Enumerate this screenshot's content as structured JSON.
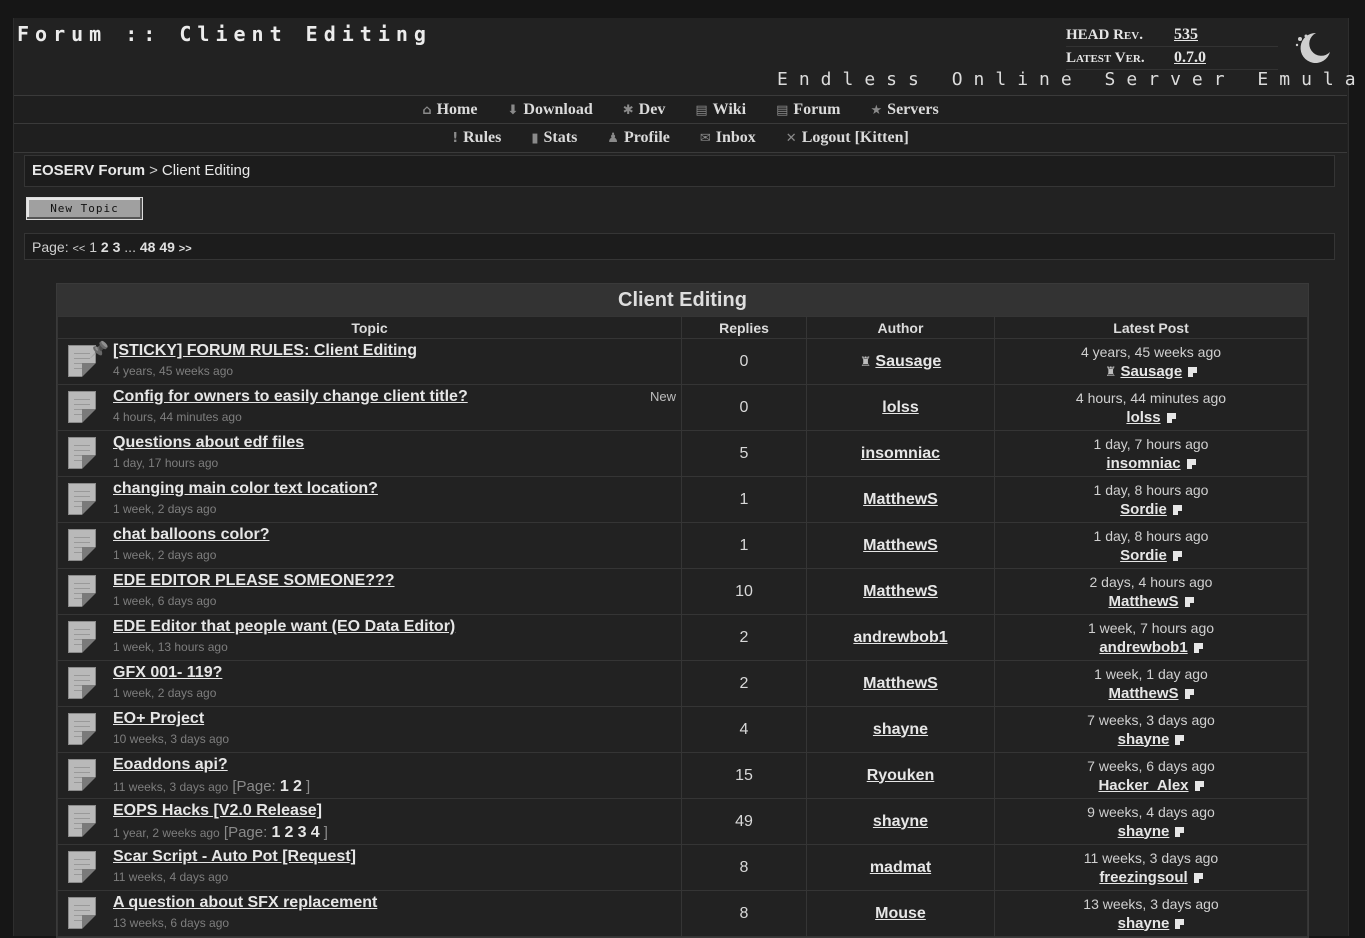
{
  "header": {
    "title": "Forum :: Client Editing",
    "subtitle": "Endless Online Server Emulator",
    "head_rev_label": "HEAD Rev.",
    "head_rev_value": "535",
    "latest_ver_label": "Latest Ver.",
    "latest_ver_value": "0.7.0"
  },
  "nav": {
    "row1": [
      {
        "label": "Home",
        "icon": "house-icon",
        "glyph": "⌂"
      },
      {
        "label": "Download",
        "icon": "download-icon",
        "glyph": "⬇"
      },
      {
        "label": "Dev",
        "icon": "bug-icon",
        "glyph": "✱"
      },
      {
        "label": "Wiki",
        "icon": "book-icon",
        "glyph": "▤"
      },
      {
        "label": "Forum",
        "icon": "document-icon",
        "glyph": "▤"
      },
      {
        "label": "Servers",
        "icon": "star-icon",
        "glyph": "★"
      }
    ],
    "row2": [
      {
        "label": "Rules",
        "icon": "exclamation-icon",
        "glyph": "!"
      },
      {
        "label": "Stats",
        "icon": "bar-chart-icon",
        "glyph": "▮"
      },
      {
        "label": "Profile",
        "icon": "person-icon",
        "glyph": "♟"
      },
      {
        "label": "Inbox",
        "icon": "envelope-icon",
        "glyph": "✉"
      },
      {
        "label": "Logout [Kitten]",
        "icon": "close-icon",
        "glyph": "✕"
      }
    ]
  },
  "breadcrumb": {
    "home": "EOSERV Forum",
    "separator": ">",
    "current": "Client Editing"
  },
  "new_topic_label": "New Topic",
  "pager": {
    "label": "Page:",
    "prev": "<<",
    "current": "1",
    "pages": [
      "2",
      "3"
    ],
    "ellipsis": "...",
    "last_pages": [
      "48",
      "49"
    ],
    "next": ">>"
  },
  "forum": {
    "title": "Client Editing",
    "columns": {
      "topic": "Topic",
      "replies": "Replies",
      "author": "Author",
      "latest": "Latest Post"
    },
    "topics": [
      {
        "title": "[STICKY] FORUM RULES: Client Editing",
        "sticky_prefix": "[STICKY]",
        "meta": "4 years, 45 weeks ago",
        "replies": "0",
        "author": "Sausage",
        "author_mod": true,
        "latest_time": "4 years, 45 weeks ago",
        "latest_user": "Sausage",
        "latest_mod": true,
        "sticky": true
      },
      {
        "title": "Config for owners to easily change client title?",
        "meta": "4 hours, 44 minutes ago",
        "new": "New",
        "replies": "0",
        "author": "lolss",
        "latest_time": "4 hours, 44 minutes ago",
        "latest_user": "lolss"
      },
      {
        "title": "Questions about edf files",
        "meta": "1 day, 17 hours ago",
        "replies": "5",
        "author": "insomniac",
        "latest_time": "1 day, 7 hours ago",
        "latest_user": "insomniac"
      },
      {
        "title": "changing main color text location?",
        "meta": "1 week, 2 days ago",
        "replies": "1",
        "author": "MatthewS",
        "latest_time": "1 day, 8 hours ago",
        "latest_user": "Sordie"
      },
      {
        "title": "chat balloons color?",
        "meta": "1 week, 2 days ago",
        "replies": "1",
        "author": "MatthewS",
        "latest_time": "1 day, 8 hours ago",
        "latest_user": "Sordie"
      },
      {
        "title": "EDE EDITOR PLEASE SOMEONE???",
        "meta": "1 week, 6 days ago",
        "replies": "10",
        "author": "MatthewS",
        "latest_time": "2 days, 4 hours ago",
        "latest_user": "MatthewS"
      },
      {
        "title": "EDE Editor that people want (EO Data Editor)",
        "meta": "1 week, 13 hours ago",
        "replies": "2",
        "author": "andrewbob1",
        "latest_time": "1 week, 7 hours ago",
        "latest_user": "andrewbob1"
      },
      {
        "title": "GFX 001- 119?",
        "meta": "1 week, 2 days ago",
        "replies": "2",
        "author": "MatthewS",
        "latest_time": "1 week, 1 day ago",
        "latest_user": "MatthewS"
      },
      {
        "title": "EO+ Project",
        "meta": "10 weeks, 3 days ago",
        "replies": "4",
        "author": "shayne",
        "latest_time": "7 weeks, 3 days ago",
        "latest_user": "shayne"
      },
      {
        "title": "Eoaddons api?",
        "meta": "11 weeks, 3 days ago",
        "page_label": "[Page:",
        "pages": [
          "1",
          "2"
        ],
        "page_close": "]",
        "replies": "15",
        "author": "Ryouken",
        "latest_time": "7 weeks, 6 days ago",
        "latest_user": "Hacker_Alex"
      },
      {
        "title": "EOPS Hacks [V2.0 Release]",
        "meta": "1 year, 2 weeks ago",
        "page_label": "[Page:",
        "pages": [
          "1",
          "2",
          "3",
          "4"
        ],
        "page_close": "]",
        "replies": "49",
        "author": "shayne",
        "latest_time": "9 weeks, 4 days ago",
        "latest_user": "shayne"
      },
      {
        "title": "Scar Script - Auto Pot [Request]",
        "meta": "11 weeks, 4 days ago",
        "replies": "8",
        "author": "madmat",
        "latest_time": "11 weeks, 3 days ago",
        "latest_user": "freezingsoul"
      },
      {
        "title": "A question about SFX replacement",
        "meta": "13 weeks, 6 days ago",
        "replies": "8",
        "author": "Mouse",
        "latest_time": "13 weeks, 3 days ago",
        "latest_user": "shayne"
      }
    ]
  },
  "colors": {
    "background": "#161616",
    "panel": "#222222",
    "header_bar": "#333333",
    "text": "#e6e6e6"
  }
}
